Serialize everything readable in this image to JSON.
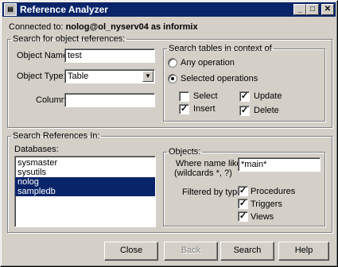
{
  "window": {
    "title": "Reference Analyzer",
    "icon": "app-icon",
    "minimize": "_",
    "maximize": "□",
    "close": "✕"
  },
  "connection": {
    "prefix": "Connected to:",
    "value": "nolog@ol_nyserv04 as informix"
  },
  "search_object": {
    "legend": "Search for object references:",
    "object_name_label": "Object Name:",
    "object_name_value": "test",
    "object_type_label": "Object Type:",
    "object_type_value": "Table",
    "column_label": "Column:",
    "column_value": ""
  },
  "search_context": {
    "legend": "Search tables in context of",
    "any_operation": "Any operation",
    "selected_operations": "Selected operations",
    "select": "Select",
    "insert": "Insert",
    "update": "Update",
    "delete": "Delete",
    "checks": {
      "select": false,
      "insert": true,
      "update": true,
      "delete": true
    }
  },
  "search_in": {
    "legend": "Search References In:",
    "databases_label": "Databases:",
    "databases": [
      {
        "name": "sysmaster",
        "selected": false
      },
      {
        "name": "sysutils",
        "selected": false
      },
      {
        "name": "nolog",
        "selected": true
      },
      {
        "name": "sampledb",
        "selected": true
      }
    ]
  },
  "objects": {
    "legend": "Objects:",
    "where_label_1": "Where name like:",
    "where_label_2": "(wildcards *, ?)",
    "where_value": "*main*",
    "filtered_label": "Filtered by type:",
    "procedures": "Procedures",
    "triggers": "Triggers",
    "views": "Views"
  },
  "buttons": {
    "close": "Close",
    "back": "Back",
    "search": "Search",
    "help": "Help"
  }
}
